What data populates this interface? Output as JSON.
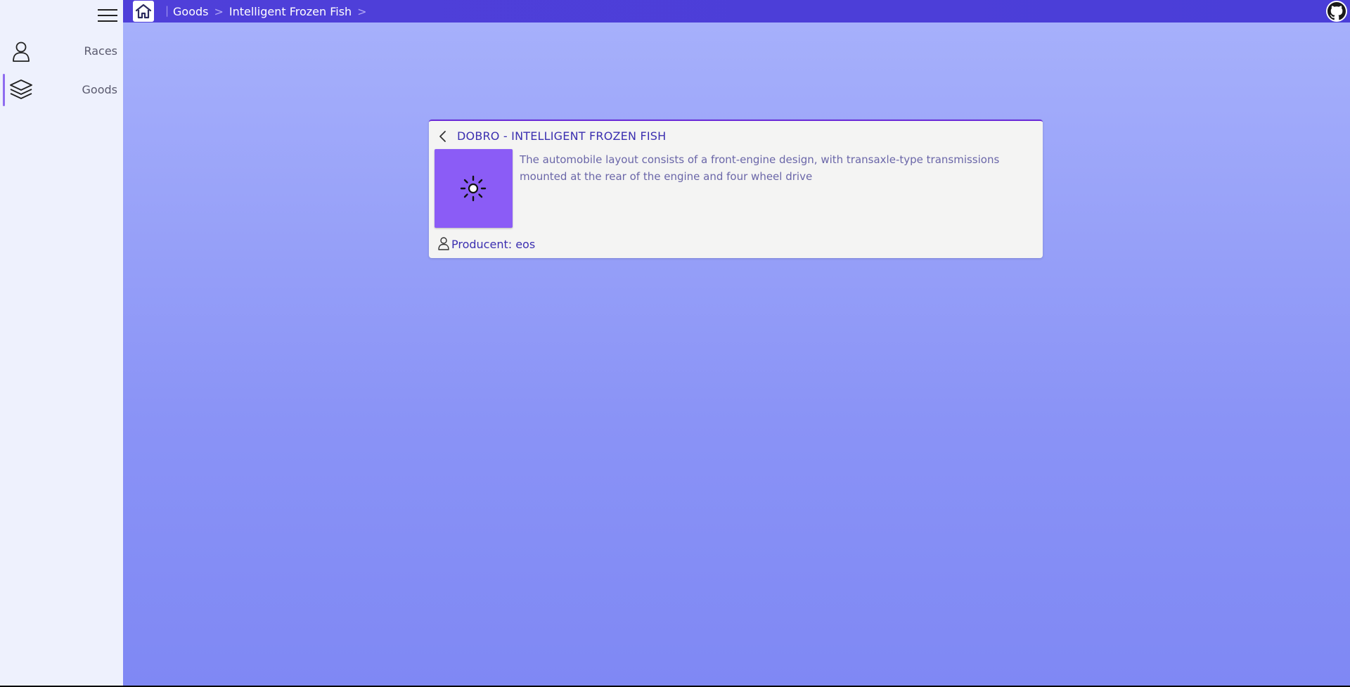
{
  "sidebar": {
    "menu_icon": "hamburger-icon",
    "items": [
      {
        "label": "Races",
        "icon": "user-icon",
        "active": false
      },
      {
        "label": "Goods",
        "icon": "layers-icon",
        "active": true
      }
    ]
  },
  "topbar": {
    "home_icon": "home-icon",
    "separator": "|",
    "breadcrumb": [
      {
        "label": "Goods"
      },
      {
        "label": "Intelligent Frozen Fish"
      }
    ],
    "crumb_sep": ">",
    "github_icon": "github-icon"
  },
  "card": {
    "back_icon": "chevron-left-icon",
    "title": "DOBRO - INTELLIGENT FROZEN FISH",
    "image_icon": "sun-icon",
    "description": "The automobile layout consists of a front-engine design, with transaxle-type transmissions mounted at the rear of the engine and four wheel drive",
    "producer_icon": "user-icon",
    "producer": "Producent: eos"
  },
  "colors": {
    "topbar": "#4f3fd9",
    "accent": "#8b5cf6",
    "card_border": "#6a2ad8",
    "sidebar_bg": "#eef1fd",
    "title_text": "#3b2fb0"
  }
}
